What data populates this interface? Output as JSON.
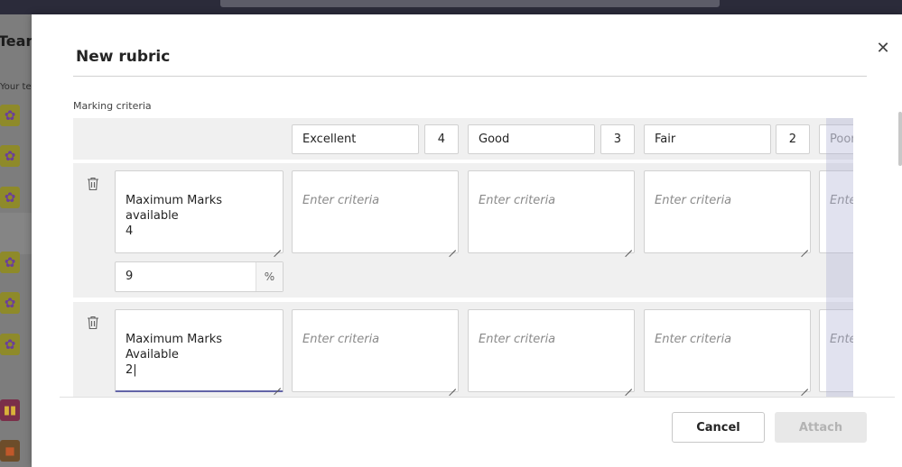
{
  "background": {
    "team_title": "Team",
    "team_subtitle": "Your tea"
  },
  "dialog": {
    "title": "New rubric",
    "section_label": "Marking criteria",
    "levels": [
      {
        "name": "Excellent",
        "points": "4"
      },
      {
        "name": "Good",
        "points": "3"
      },
      {
        "name": "Fair",
        "points": "2"
      },
      {
        "name": "Poor",
        "points": ""
      }
    ],
    "criteria": [
      {
        "description": "Maximum Marks available\n4",
        "weight": "9",
        "weight_unit": "%",
        "cell_placeholder": "Enter criteria"
      },
      {
        "description": "Maximum Marks Available\n2|",
        "cell_placeholder": "Enter criteria"
      }
    ],
    "buttons": {
      "cancel": "Cancel",
      "attach": "Attach"
    },
    "colors": {
      "accent": "#6264a7",
      "focus_underline": "#6264a7"
    }
  },
  "icons": {
    "close": "close-icon",
    "delete": "trash-icon",
    "team": "gear-icon"
  }
}
